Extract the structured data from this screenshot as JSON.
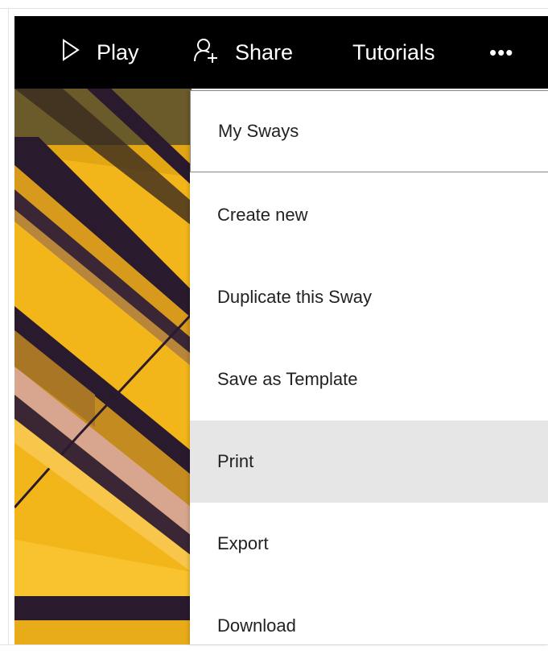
{
  "toolbar": {
    "play_label": "Play",
    "play_icon": "play-icon",
    "share_label": "Share",
    "share_icon": "share-person-icon",
    "tutorials_label": "Tutorials",
    "more_label": "•••",
    "more_icon": "more-icon"
  },
  "menu": {
    "items": [
      {
        "label": "My Sways",
        "state": "focused"
      },
      {
        "label": "Create new",
        "state": "normal"
      },
      {
        "label": "Duplicate this Sway",
        "state": "normal"
      },
      {
        "label": "Save as Template",
        "state": "normal"
      },
      {
        "label": "Print",
        "state": "hovered"
      },
      {
        "label": "Export",
        "state": "normal"
      },
      {
        "label": "Download",
        "state": "normal"
      }
    ]
  },
  "colors": {
    "toolbar_bg": "#000000",
    "toolbar_text": "#ffffff",
    "menu_bg": "#ffffff",
    "menu_hover": "#e6e6e6",
    "image_primary": "#f3b61a",
    "image_dark": "#2a1a2e"
  }
}
